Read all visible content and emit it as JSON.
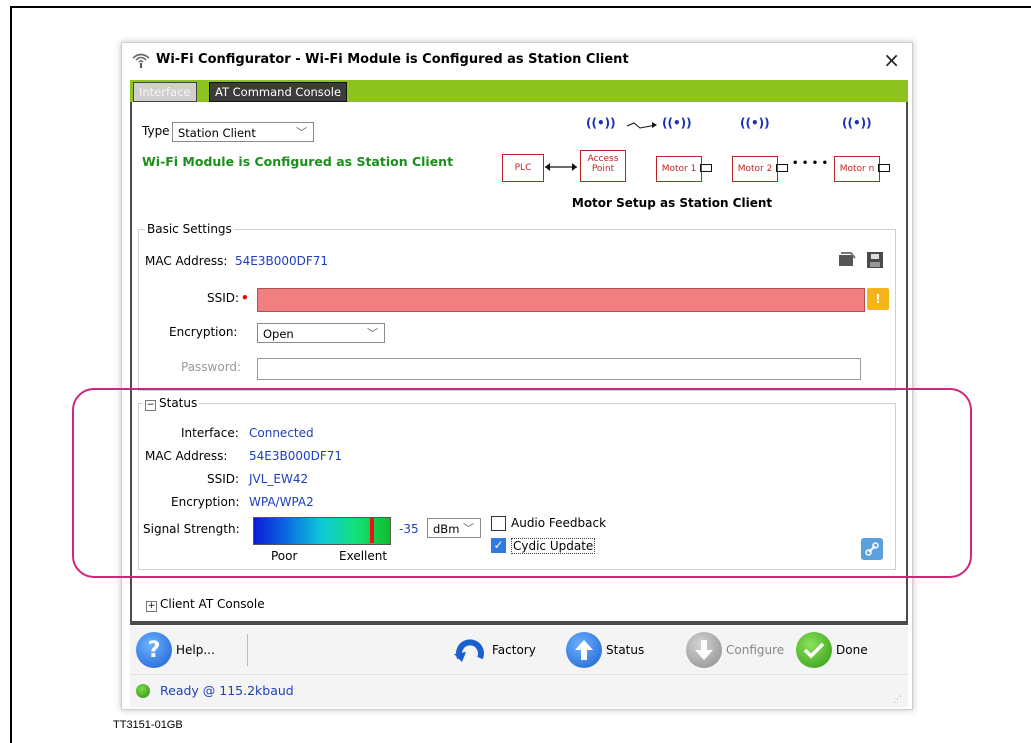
{
  "window": {
    "title": "Wi-Fi Configurator - Wi-Fi Module is Configured as Station Client",
    "close_label": "×"
  },
  "tabs": [
    {
      "label": "Interface",
      "active": true
    },
    {
      "label": "AT Command Console",
      "active": false
    }
  ],
  "interface": {
    "type_label": "Type",
    "type_value": "Station Client",
    "configured_message": "Wi-Fi Module is Configured as Station Client"
  },
  "diagram": {
    "plc": "PLC",
    "access_point": "Access Point",
    "motor1": "Motor 1",
    "motor2": "Motor 2",
    "motorn": "Motor n",
    "antenna_glyph": "((•))",
    "dots": "• • • •",
    "caption": "Motor Setup as Station Client"
  },
  "basic_settings": {
    "legend": "Basic Settings",
    "mac_label": "MAC Address:",
    "mac_value": "54E3B000DF71",
    "ssid_label": "SSID:",
    "ssid_value": "",
    "required_marker": "•",
    "encryption_label": "Encryption:",
    "encryption_value": "Open",
    "password_label": "Password:",
    "password_value": "",
    "warn_glyph": "!"
  },
  "status": {
    "expander": "−",
    "legend": "Status",
    "interface_label": "Interface:",
    "interface_value": "Connected",
    "mac_label": "MAC Address:",
    "mac_value": "54E3B000DF71",
    "ssid_label": "SSID:",
    "ssid_value": "JVL_EW42",
    "encryption_label": "Encryption:",
    "encryption_value": "WPA/WPA2",
    "signal_label": "Signal Strength:",
    "signal_value": "-35",
    "signal_unit": "dBm",
    "signal_fraction": 0.88,
    "poor_label": "Poor",
    "excellent_label": "Exellent",
    "audio_feedback_label": "Audio Feedback",
    "audio_feedback_checked": false,
    "cyclic_update_label": "Cydic Update",
    "cyclic_update_checked": true
  },
  "client_console": {
    "expander": "+",
    "label": "Client AT Console"
  },
  "toolbar": {
    "help": "Help...",
    "factory": "Factory",
    "status": "Status",
    "configure": "Configure",
    "done": "Done"
  },
  "statusbar": {
    "text": "Ready @ 115.2kbaud"
  },
  "figure_id": "TT3151-01GB",
  "colors": {
    "tab_green": "#8dc21f",
    "ok_green": "#1b8f1b",
    "value_blue": "#1e3fbf",
    "ssid_error": "#f08080",
    "highlight": "#d0257a"
  }
}
